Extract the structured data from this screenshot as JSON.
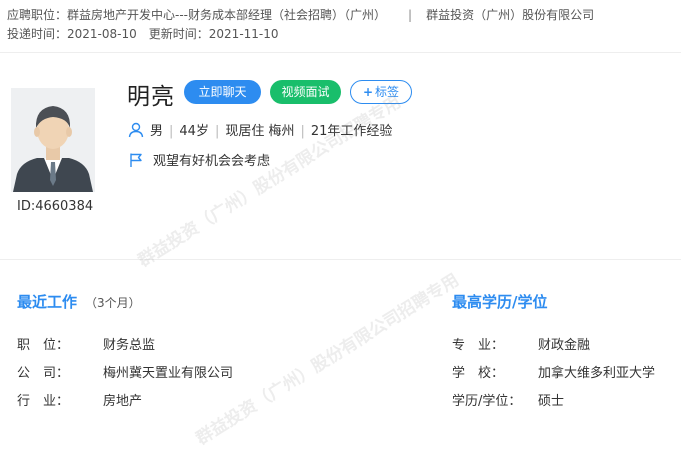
{
  "header": {
    "position_label": "应聘职位：",
    "position_value": "群益房地产开发中心---财务成本部经理（社会招聘）（广州）",
    "separator": "|",
    "company": "群益投资（广州）股份有限公司",
    "delivery_label": "投递时间：",
    "delivery_value": "2021-08-10",
    "update_label": "更新时间：",
    "update_value": "2021-11-10"
  },
  "profile": {
    "name": "明亮",
    "id_text": "ID:4660384",
    "chat_button": "立即聊天",
    "video_button": "视频面试",
    "tag_button_plus": "+",
    "tag_button": "标签",
    "gender": "男",
    "age": "44岁",
    "residence": "现居住 梅州",
    "experience": "21年工作经验",
    "meta_separator": "|",
    "job_status": "观望有好机会会考虑"
  },
  "recent_work": {
    "title": "最近工作",
    "duration": "（3个月）",
    "fields": [
      {
        "label": "职　位：",
        "value": "财务总监"
      },
      {
        "label": "公　司：",
        "value": "梅州冀天置业有限公司"
      },
      {
        "label": "行　业：",
        "value": "房地产"
      }
    ]
  },
  "education": {
    "title": "最高学历/学位",
    "fields": [
      {
        "label": "专　业：",
        "value": "财政金融"
      },
      {
        "label": "学　校：",
        "value": "加拿大维多利亚大学"
      },
      {
        "label": "学历/学位：",
        "value": "硕士"
      }
    ]
  },
  "watermark": {
    "line1": "群益投资（广州）股份有限公司招聘专用"
  },
  "colors": {
    "accent": "#2d8cf0",
    "green": "#19be6b"
  }
}
